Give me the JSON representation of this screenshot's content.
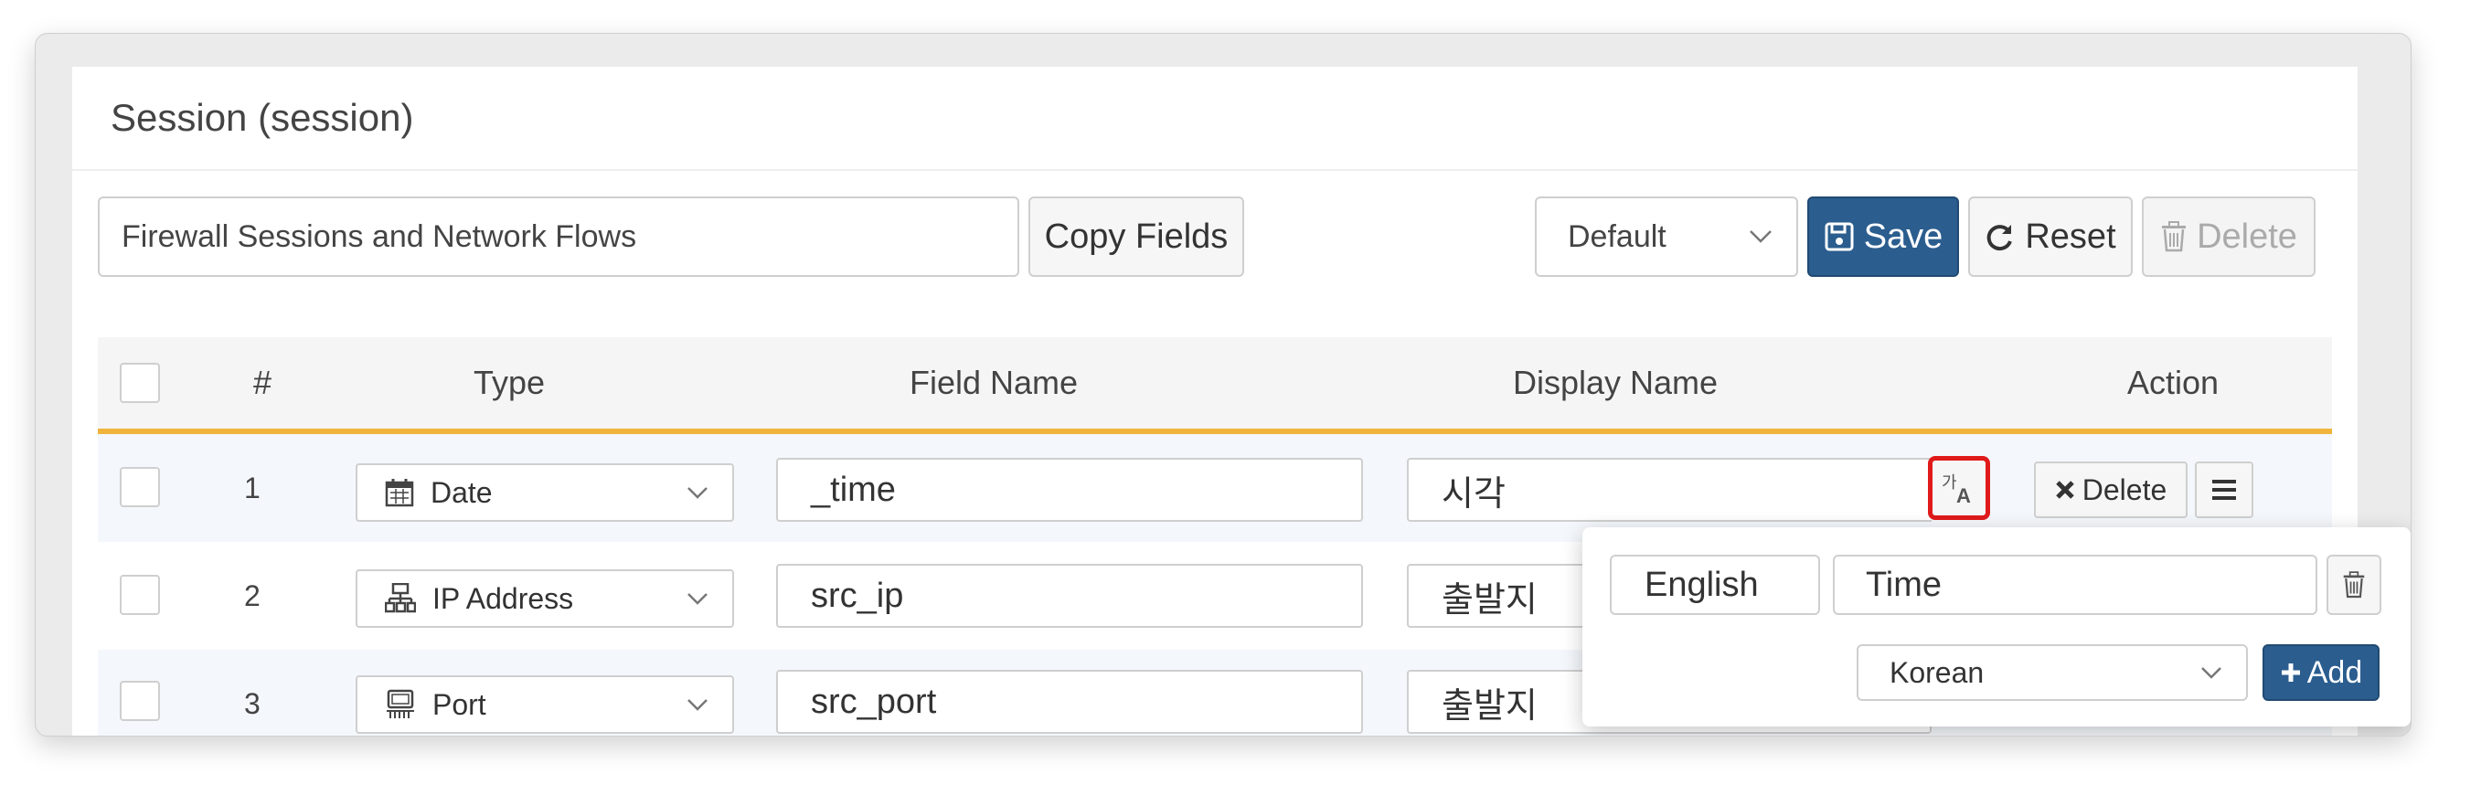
{
  "panel": {
    "title": "Session (session)"
  },
  "toolbar": {
    "description_value": "Firewall Sessions and Network Flows",
    "copy_fields_label": "Copy Fields",
    "profile_select_value": "Default",
    "save_label": "Save",
    "reset_label": "Reset",
    "delete_label": "Delete"
  },
  "table": {
    "headers": {
      "num": "#",
      "type": "Type",
      "field_name": "Field Name",
      "display_name": "Display Name",
      "action": "Action"
    },
    "rows": [
      {
        "num": "1",
        "type": "Date",
        "type_icon": "calendar-icon",
        "field_name": "_time",
        "display_name": "시각",
        "delete_label": "Delete"
      },
      {
        "num": "2",
        "type": "IP Address",
        "type_icon": "network-icon",
        "field_name": "src_ip",
        "display_name": "출발지"
      },
      {
        "num": "3",
        "type": "Port",
        "type_icon": "port-icon",
        "field_name": "src_port",
        "display_name": "출발지"
      }
    ]
  },
  "popover": {
    "language_label": "English",
    "translation_value": "Time",
    "new_language_select": "Korean",
    "add_label": "Add"
  },
  "colors": {
    "primary": "#2b5d8e",
    "header_underline": "#f0b43c",
    "highlight": "#e01a1a"
  }
}
